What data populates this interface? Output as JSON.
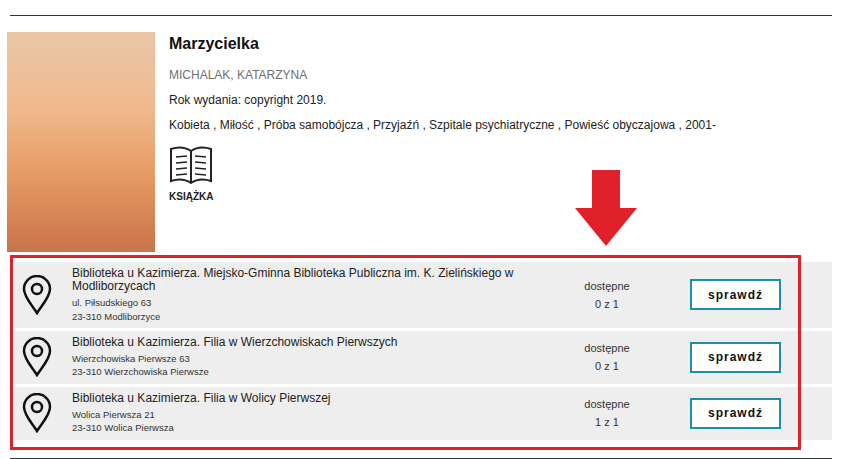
{
  "book": {
    "title": "Marzycielka",
    "author": "MICHALAK, KATARZYNA",
    "year": "Rok wydania: copyright 2019.",
    "subjects": "Kobieta , Miłość , Próba samobójcza , Przyjaźń , Szpitale psychiatryczne , Powieść obyczajowa , 2001-",
    "format": "KSIĄŻKA"
  },
  "libraries": [
    {
      "name": "Biblioteka u Kazimierza. Miejsko-Gminna Biblioteka Publiczna im. K. Zielińskiego w Modliborzycach",
      "street": "ul. Piłsudskiego 63",
      "city": "23-310 Modliborzyce",
      "status": "dostępne",
      "count": "0 z 1",
      "button": "sprawdź"
    },
    {
      "name": "Biblioteka u Kazimierza. Filia w Wierzchowiskach Pierwszych",
      "street": "Wierzchowiska Pierwsze 63",
      "city": "23-310 Wierzchowiska Pierwsze",
      "status": "dostępne",
      "count": "0 z 1",
      "button": "sprawdź"
    },
    {
      "name": "Biblioteka u Kazimierza. Filia w Wolicy Pierwszej",
      "street": "Wolica Pierwsza 21",
      "city": "23-310 Wolica Pierwsza",
      "status": "dostępne",
      "count": "1 z 1",
      "button": "sprawdź"
    }
  ]
}
